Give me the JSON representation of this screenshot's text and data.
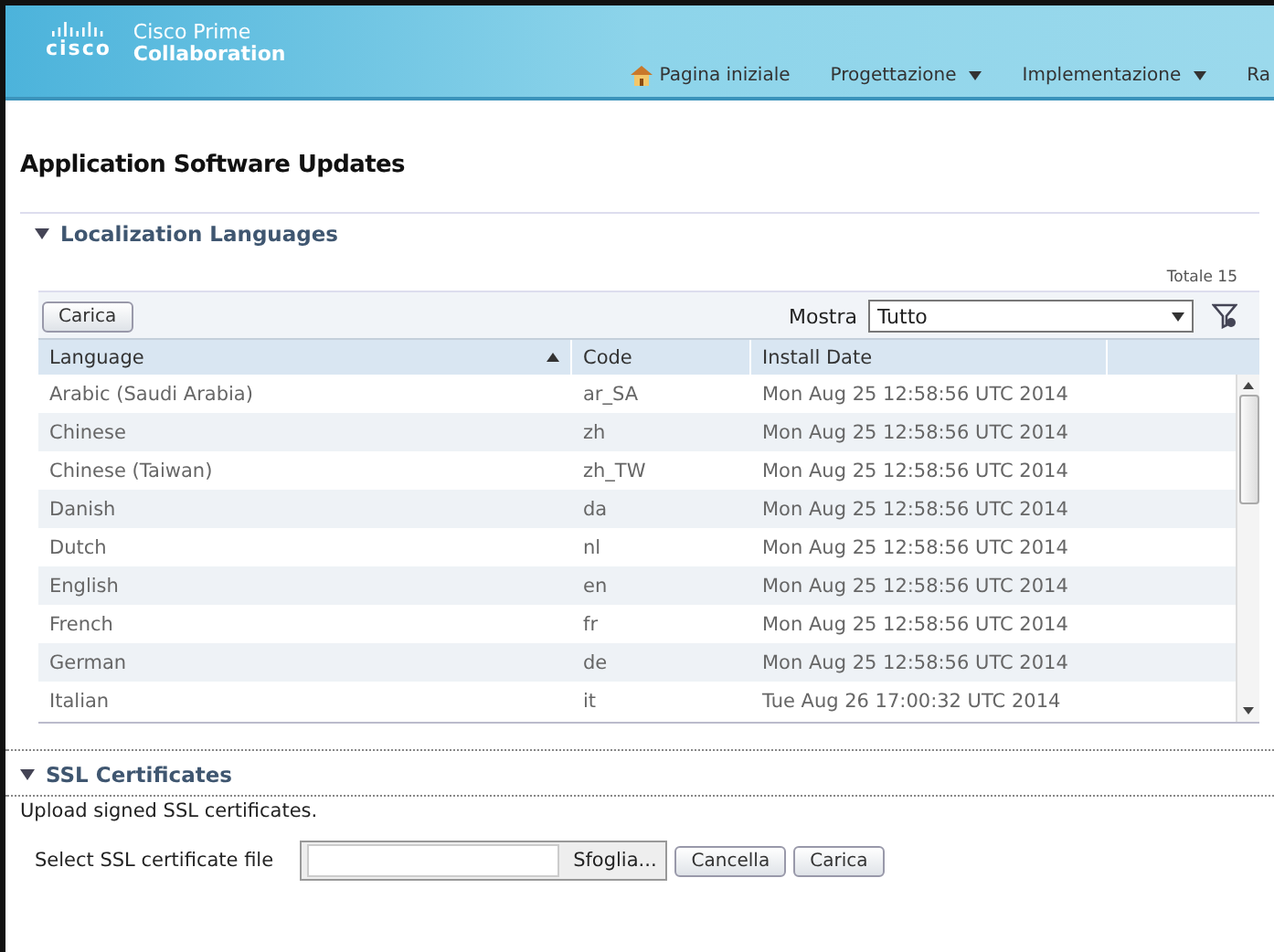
{
  "header": {
    "logo_mark": "cisco",
    "product_line1": "Cisco Prime",
    "product_line2": "Collaboration",
    "nav": [
      {
        "label": "Pagina iniziale",
        "kind": "home"
      },
      {
        "label": "Progettazione",
        "kind": "menu"
      },
      {
        "label": "Implementazione",
        "kind": "menu"
      },
      {
        "label": "Ra",
        "kind": "plain"
      }
    ]
  },
  "page_title": "Application Software Updates",
  "localization": {
    "title": "Localization Languages",
    "expanded": true,
    "total": "Totale 15",
    "upload_button": "Carica",
    "show_label": "Mostra",
    "show_value": "Tutto",
    "columns": [
      {
        "label": "Language",
        "sorted": true
      },
      {
        "label": "Code",
        "sorted": false
      },
      {
        "label": "Install Date",
        "sorted": false
      }
    ],
    "rows": [
      [
        "Arabic (Saudi Arabia)",
        "ar_SA",
        "Mon Aug 25 12:58:56 UTC 2014"
      ],
      [
        "Chinese",
        "zh",
        "Mon Aug 25 12:58:56 UTC 2014"
      ],
      [
        "Chinese (Taiwan)",
        "zh_TW",
        "Mon Aug 25 12:58:56 UTC 2014"
      ],
      [
        "Danish",
        "da",
        "Mon Aug 25 12:58:56 UTC 2014"
      ],
      [
        "Dutch",
        "nl",
        "Mon Aug 25 12:58:56 UTC 2014"
      ],
      [
        "English",
        "en",
        "Mon Aug 25 12:58:56 UTC 2014"
      ],
      [
        "French",
        "fr",
        "Mon Aug 25 12:58:56 UTC 2014"
      ],
      [
        "German",
        "de",
        "Mon Aug 25 12:58:56 UTC 2014"
      ],
      [
        "Italian",
        "it",
        "Tue Aug 26 17:00:32 UTC 2014"
      ]
    ]
  },
  "ssl": {
    "title": "SSL Certificates",
    "expanded": true,
    "description": "Upload signed SSL certificates.",
    "file_label": "Select SSL certificate file",
    "browse_button": "Sfoglia...",
    "buttons": [
      "Cancella",
      "Carica"
    ]
  }
}
